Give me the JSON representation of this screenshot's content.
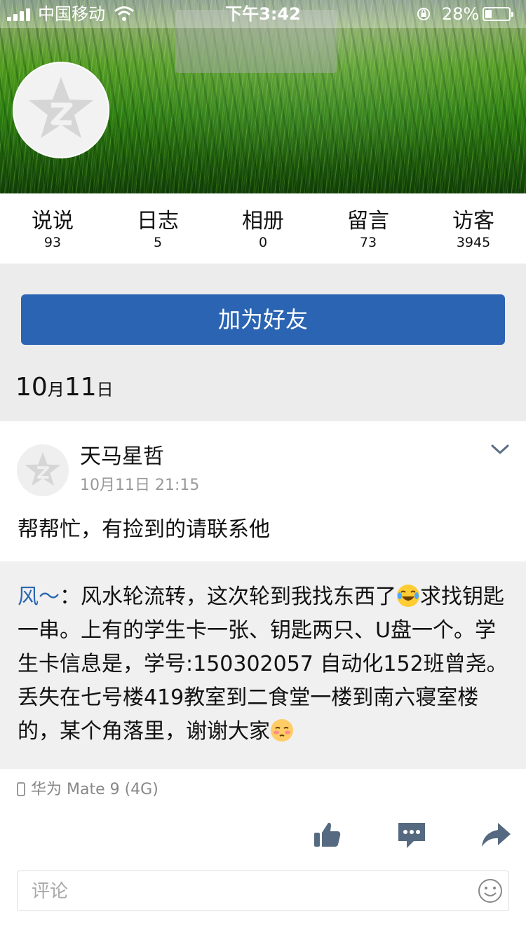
{
  "status_bar": {
    "carrier": "中国移动",
    "time": "下午3:42",
    "battery": "28%"
  },
  "stats": [
    {
      "label": "说说",
      "value": "93"
    },
    {
      "label": "日志",
      "value": "5"
    },
    {
      "label": "相册",
      "value": "0"
    },
    {
      "label": "留言",
      "value": "73"
    },
    {
      "label": "访客",
      "value": "3945"
    }
  ],
  "add_friend_label": "加为好友",
  "date_header": {
    "month": "10",
    "month_unit": "月",
    "day": "11",
    "day_unit": "日"
  },
  "post": {
    "author": "天马星哲",
    "time": "10月11日 21:15",
    "text": "帮帮忙，有捡到的请联系他",
    "forward": {
      "name": "风～",
      "sep": "：",
      "part1": "风水轮流转，这次轮到我找东西了",
      "part2": "求找钥匙一串。上有的学生卡一张、钥匙两只、U盘一个。学生卡信息是，学号:150302057 自动化152班曾尧。丢失在七号楼419教室到二食堂一楼到南六寝室楼的，某个角落里，谢谢大家"
    },
    "device": "华为 Mate 9 (4G)"
  },
  "comment_placeholder": "评论",
  "colors": {
    "accent": "#2a64b2",
    "link": "#2b67b1"
  }
}
